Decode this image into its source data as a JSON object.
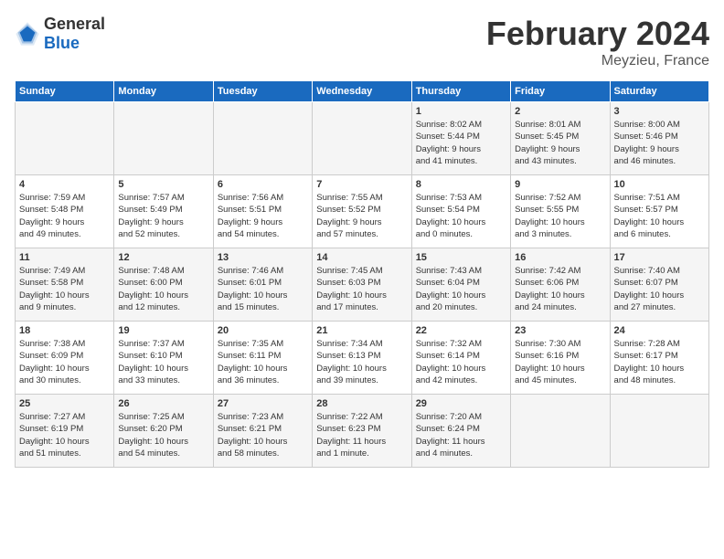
{
  "header": {
    "logo_general": "General",
    "logo_blue": "Blue",
    "title": "February 2024",
    "location": "Meyzieu, France"
  },
  "days_of_week": [
    "Sunday",
    "Monday",
    "Tuesday",
    "Wednesday",
    "Thursday",
    "Friday",
    "Saturday"
  ],
  "weeks": [
    [
      {
        "day": "",
        "info": ""
      },
      {
        "day": "",
        "info": ""
      },
      {
        "day": "",
        "info": ""
      },
      {
        "day": "",
        "info": ""
      },
      {
        "day": "1",
        "info": "Sunrise: 8:02 AM\nSunset: 5:44 PM\nDaylight: 9 hours\nand 41 minutes."
      },
      {
        "day": "2",
        "info": "Sunrise: 8:01 AM\nSunset: 5:45 PM\nDaylight: 9 hours\nand 43 minutes."
      },
      {
        "day": "3",
        "info": "Sunrise: 8:00 AM\nSunset: 5:46 PM\nDaylight: 9 hours\nand 46 minutes."
      }
    ],
    [
      {
        "day": "4",
        "info": "Sunrise: 7:59 AM\nSunset: 5:48 PM\nDaylight: 9 hours\nand 49 minutes."
      },
      {
        "day": "5",
        "info": "Sunrise: 7:57 AM\nSunset: 5:49 PM\nDaylight: 9 hours\nand 52 minutes."
      },
      {
        "day": "6",
        "info": "Sunrise: 7:56 AM\nSunset: 5:51 PM\nDaylight: 9 hours\nand 54 minutes."
      },
      {
        "day": "7",
        "info": "Sunrise: 7:55 AM\nSunset: 5:52 PM\nDaylight: 9 hours\nand 57 minutes."
      },
      {
        "day": "8",
        "info": "Sunrise: 7:53 AM\nSunset: 5:54 PM\nDaylight: 10 hours\nand 0 minutes."
      },
      {
        "day": "9",
        "info": "Sunrise: 7:52 AM\nSunset: 5:55 PM\nDaylight: 10 hours\nand 3 minutes."
      },
      {
        "day": "10",
        "info": "Sunrise: 7:51 AM\nSunset: 5:57 PM\nDaylight: 10 hours\nand 6 minutes."
      }
    ],
    [
      {
        "day": "11",
        "info": "Sunrise: 7:49 AM\nSunset: 5:58 PM\nDaylight: 10 hours\nand 9 minutes."
      },
      {
        "day": "12",
        "info": "Sunrise: 7:48 AM\nSunset: 6:00 PM\nDaylight: 10 hours\nand 12 minutes."
      },
      {
        "day": "13",
        "info": "Sunrise: 7:46 AM\nSunset: 6:01 PM\nDaylight: 10 hours\nand 15 minutes."
      },
      {
        "day": "14",
        "info": "Sunrise: 7:45 AM\nSunset: 6:03 PM\nDaylight: 10 hours\nand 17 minutes."
      },
      {
        "day": "15",
        "info": "Sunrise: 7:43 AM\nSunset: 6:04 PM\nDaylight: 10 hours\nand 20 minutes."
      },
      {
        "day": "16",
        "info": "Sunrise: 7:42 AM\nSunset: 6:06 PM\nDaylight: 10 hours\nand 24 minutes."
      },
      {
        "day": "17",
        "info": "Sunrise: 7:40 AM\nSunset: 6:07 PM\nDaylight: 10 hours\nand 27 minutes."
      }
    ],
    [
      {
        "day": "18",
        "info": "Sunrise: 7:38 AM\nSunset: 6:09 PM\nDaylight: 10 hours\nand 30 minutes."
      },
      {
        "day": "19",
        "info": "Sunrise: 7:37 AM\nSunset: 6:10 PM\nDaylight: 10 hours\nand 33 minutes."
      },
      {
        "day": "20",
        "info": "Sunrise: 7:35 AM\nSunset: 6:11 PM\nDaylight: 10 hours\nand 36 minutes."
      },
      {
        "day": "21",
        "info": "Sunrise: 7:34 AM\nSunset: 6:13 PM\nDaylight: 10 hours\nand 39 minutes."
      },
      {
        "day": "22",
        "info": "Sunrise: 7:32 AM\nSunset: 6:14 PM\nDaylight: 10 hours\nand 42 minutes."
      },
      {
        "day": "23",
        "info": "Sunrise: 7:30 AM\nSunset: 6:16 PM\nDaylight: 10 hours\nand 45 minutes."
      },
      {
        "day": "24",
        "info": "Sunrise: 7:28 AM\nSunset: 6:17 PM\nDaylight: 10 hours\nand 48 minutes."
      }
    ],
    [
      {
        "day": "25",
        "info": "Sunrise: 7:27 AM\nSunset: 6:19 PM\nDaylight: 10 hours\nand 51 minutes."
      },
      {
        "day": "26",
        "info": "Sunrise: 7:25 AM\nSunset: 6:20 PM\nDaylight: 10 hours\nand 54 minutes."
      },
      {
        "day": "27",
        "info": "Sunrise: 7:23 AM\nSunset: 6:21 PM\nDaylight: 10 hours\nand 58 minutes."
      },
      {
        "day": "28",
        "info": "Sunrise: 7:22 AM\nSunset: 6:23 PM\nDaylight: 11 hours\nand 1 minute."
      },
      {
        "day": "29",
        "info": "Sunrise: 7:20 AM\nSunset: 6:24 PM\nDaylight: 11 hours\nand 4 minutes."
      },
      {
        "day": "",
        "info": ""
      },
      {
        "day": "",
        "info": ""
      }
    ]
  ]
}
